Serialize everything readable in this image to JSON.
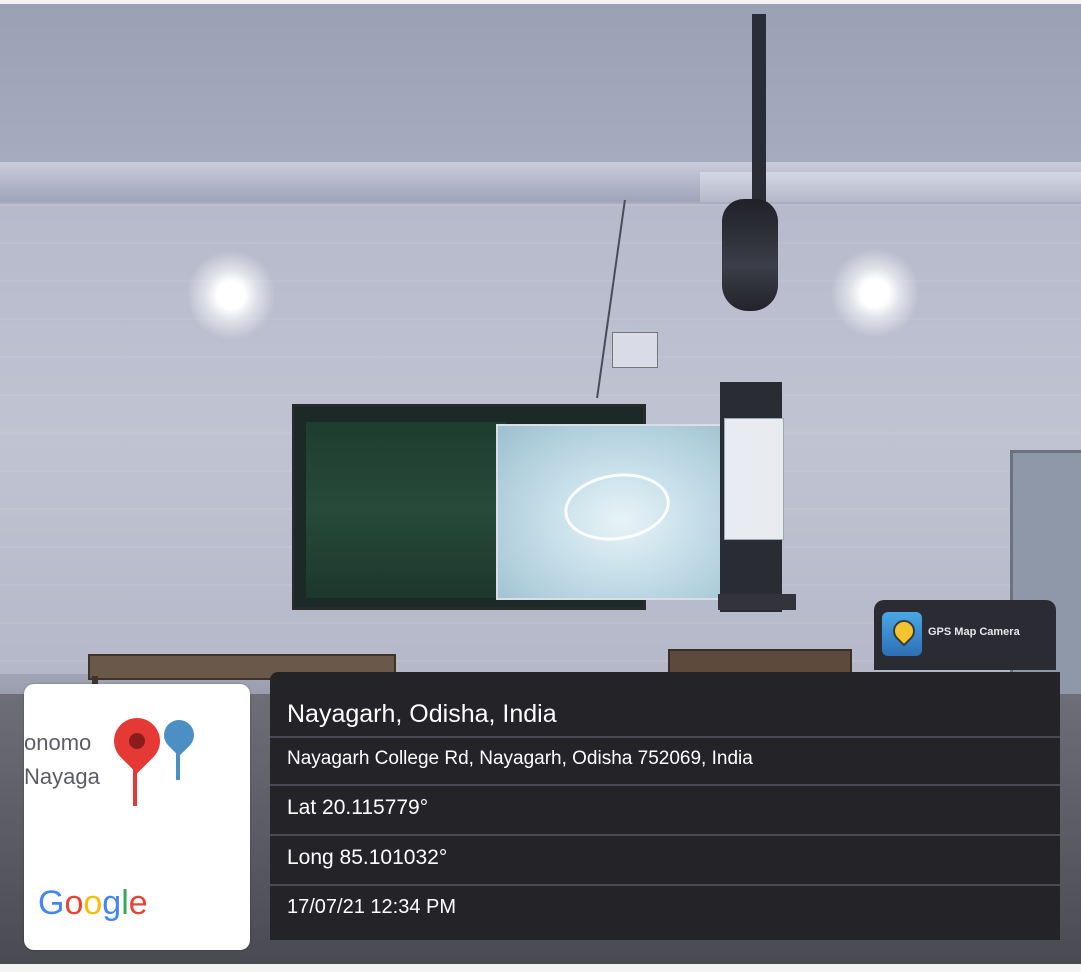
{
  "app": {
    "name": "GPS Map Camera",
    "icon": "gps-map-camera-icon"
  },
  "location": {
    "title": "Nayagarh, Odisha, India",
    "address": "Nayagarh College Rd, Nayagarh, Odisha 752069, India",
    "latitude": "Lat 20.115779°",
    "longitude": "Long 85.101032°",
    "datetime": "17/07/21 12:34 PM"
  },
  "map": {
    "label_line1": "onomo",
    "label_line2": "Nayaga",
    "logo_text": [
      "G",
      "o",
      "o",
      "g",
      "l",
      "e"
    ],
    "pin_icon": "map-pin-icon",
    "college_pin_icon": "college-pin-icon"
  },
  "colors": {
    "overlay_bg": "#232328",
    "overlay_text": "#ffffff",
    "pin_red": "#e53935",
    "pin_blue": "#4b8fc4"
  }
}
